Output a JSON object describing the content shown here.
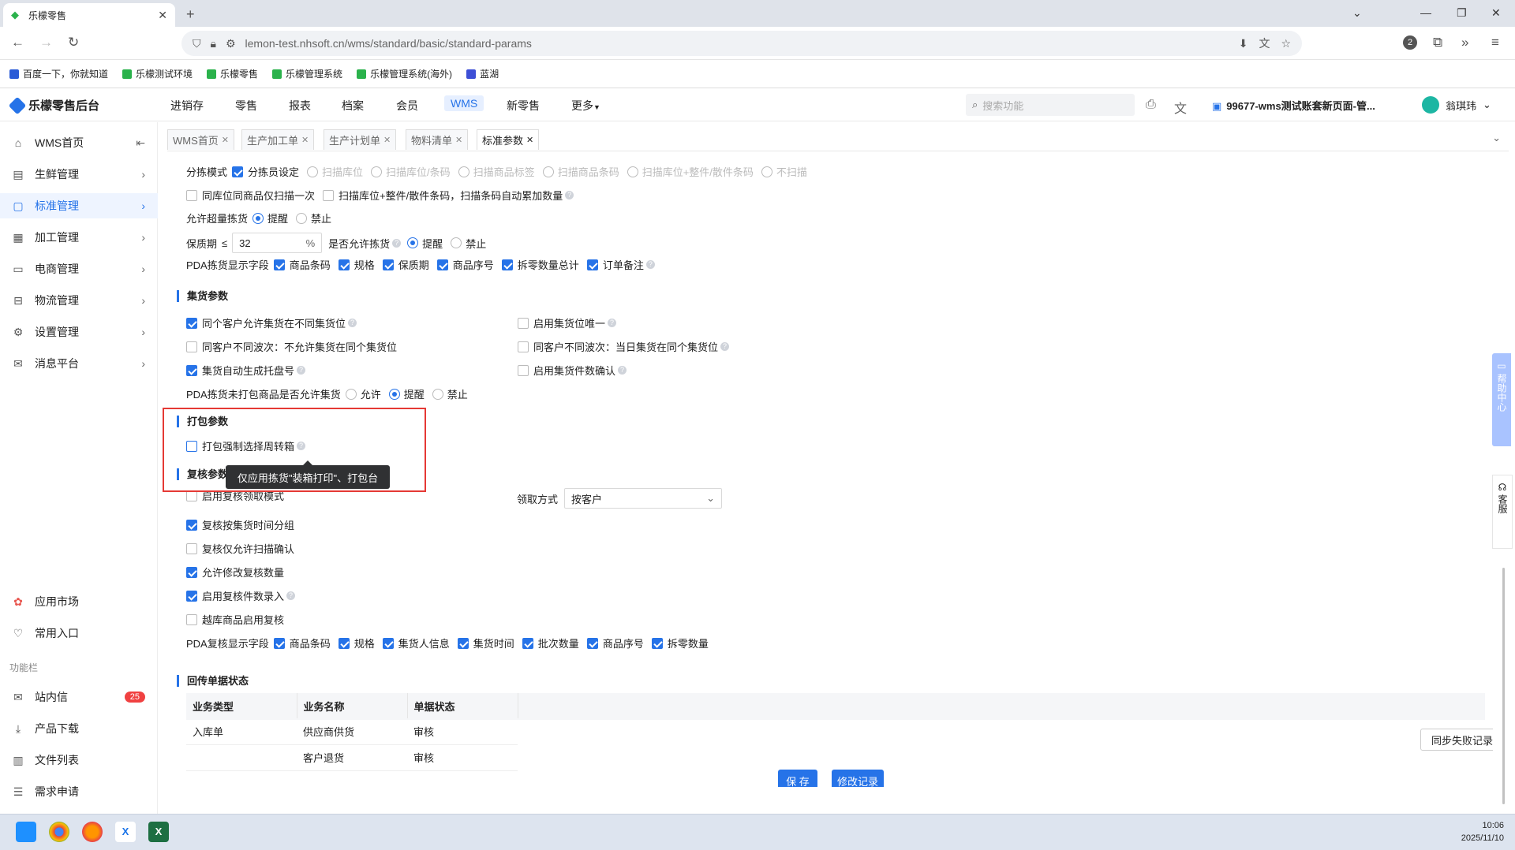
{
  "browser": {
    "tab_title": "乐檬零售",
    "url": "lemon-test.nhsoft.cn/wms/standard/basic/standard-params",
    "badge_count": "2",
    "bookmarks": [
      "百度一下，你就知道",
      "乐檬测试环境",
      "乐檬零售",
      "乐檬管理系统",
      "乐檬管理系统(海外)",
      "蓝湖"
    ]
  },
  "app": {
    "logo": "乐檬零售后台",
    "top_menu": [
      "进销存",
      "零售",
      "报表",
      "档案",
      "会员",
      "WMS",
      "新零售",
      "更多"
    ],
    "active_menu": "WMS",
    "search_placeholder": "搜索功能",
    "account": "99677-wms测试账套新页面-管...",
    "user": "翁琪玮"
  },
  "sidebar": {
    "items": [
      {
        "label": "WMS首页",
        "icon": "home-icon"
      },
      {
        "label": "生鲜管理",
        "icon": "fresh-icon"
      },
      {
        "label": "标准管理",
        "icon": "standard-icon"
      },
      {
        "label": "加工管理",
        "icon": "process-icon"
      },
      {
        "label": "电商管理",
        "icon": "ecommerce-icon"
      },
      {
        "label": "物流管理",
        "icon": "logistics-icon"
      },
      {
        "label": "设置管理",
        "icon": "settings-icon"
      },
      {
        "label": "消息平台",
        "icon": "message-icon"
      }
    ],
    "bottom": [
      {
        "label": "应用市场",
        "icon": "app-market-icon"
      },
      {
        "label": "常用入口",
        "icon": "heart-icon"
      }
    ],
    "section_label": "功能栏",
    "func": [
      {
        "label": "站内信",
        "icon": "mail-icon",
        "badge": "25"
      },
      {
        "label": "产品下载",
        "icon": "download-icon"
      },
      {
        "label": "文件列表",
        "icon": "file-list-icon"
      },
      {
        "label": "需求申请",
        "icon": "request-icon"
      }
    ]
  },
  "page_tabs": [
    "WMS首页",
    "生产加工单",
    "生产计划单",
    "物料清单",
    "标准参数"
  ],
  "sorting": {
    "mode_label": "分拣模式",
    "mode_options": [
      "分拣员设定",
      "扫描库位",
      "扫描库位/条码",
      "扫描商品标签",
      "扫描商品条码",
      "扫描库位+整件/散件条码",
      "不扫描"
    ],
    "same_location_label": "同库位同商品仅扫描一次",
    "auto_accumulate_label": "扫描库位+整件/散件条码，扫描条码自动累加数量",
    "overweight_label": "允许超量拣货",
    "remind": "提醒",
    "forbid": "禁止",
    "shelf_label": "保质期",
    "shelf_op": "≤",
    "shelf_value": "32",
    "shelf_unit": "%",
    "shelf_allow_label": "是否允许拣货",
    "pda_fields_label": "PDA拣货显示字段",
    "pda_fields": [
      "商品条码",
      "规格",
      "保质期",
      "商品序号",
      "拆零数量总计",
      "订单备注"
    ]
  },
  "collect": {
    "title": "集货参数",
    "left": [
      "同个客户允许集货在不同集货位",
      "同客户不同波次：不允许集货在同个集货位",
      "集货自动生成托盘号"
    ],
    "right": [
      "启用集货位唯一",
      "同客户不同波次：当日集货在同个集货位",
      "启用集货件数确认"
    ],
    "pda_label": "PDA拣货未打包商品是否允许集货",
    "allow": "允许",
    "remind": "提醒",
    "forbid": "禁止"
  },
  "pack": {
    "title": "打包参数",
    "force_box_label": "打包强制选择周转箱",
    "tooltip": "仅应用拣货\"装箱打印\"、打包台"
  },
  "review": {
    "title": "复核参数",
    "items": [
      "启用复核领取模式",
      "复核按集货时间分组",
      "复核仅允许扫描确认",
      "允许修改复核数量",
      "启用复核件数录入",
      "越库商品启用复核"
    ],
    "claim_label": "领取方式",
    "claim_value": "按客户",
    "pda_label": "PDA复核显示字段",
    "pda_fields": [
      "商品条码",
      "规格",
      "集货人信息",
      "集货时间",
      "批次数量",
      "商品序号",
      "拆零数量"
    ]
  },
  "callback": {
    "title": "回传单据状态",
    "headers": [
      "业务类型",
      "业务名称",
      "单据状态"
    ],
    "rows": [
      [
        "入库单",
        "供应商供货",
        "审核"
      ],
      [
        "",
        "客户退货",
        "审核"
      ]
    ],
    "sync_button": "同步失败记录"
  },
  "footer": {
    "save": "保 存",
    "history": "修改记录"
  },
  "side_help": {
    "help": "帮助中心",
    "service": "客服"
  },
  "clock": {
    "time": "10:06",
    "date": "2025/11/10"
  }
}
